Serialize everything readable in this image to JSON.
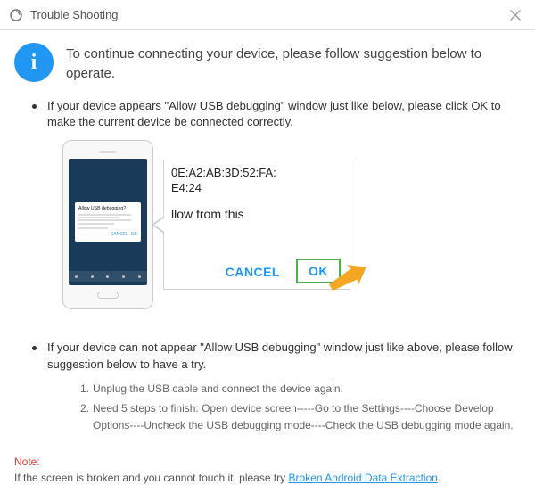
{
  "window": {
    "title": "Trouble Shooting"
  },
  "headline": "To continue connecting your device, please follow suggestion below to operate.",
  "bullet1": "If your device appears \"Allow USB debugging\" window just like below, please click OK to make the current device  be connected correctly.",
  "illustration": {
    "mini_dialog_title": "Allow USB debugging?",
    "zoom_line1": "0E:A2:AB:3D:52:FA:",
    "zoom_line2": "E4:24",
    "zoom_line3": "llow from this",
    "cancel": "CANCEL",
    "ok": "OK"
  },
  "bullet2": "If your device can not appear \"Allow USB debugging\" window just like above, please follow suggestion below to have a try.",
  "steps": {
    "s1_num": "1.",
    "s1_text": "Unplug the USB cable and connect the device again.",
    "s2_num": "2.",
    "s2_text": "Need 5 steps to finish: Open device screen-----Go to the Settings----Choose Develop Options----Uncheck the USB debugging mode----Check the USB debugging mode again."
  },
  "footer": {
    "note_label": "Note:",
    "text_prefix": "If the screen is broken and you cannot touch it, please try ",
    "link": "Broken Android Data Extraction",
    "text_suffix": "."
  }
}
